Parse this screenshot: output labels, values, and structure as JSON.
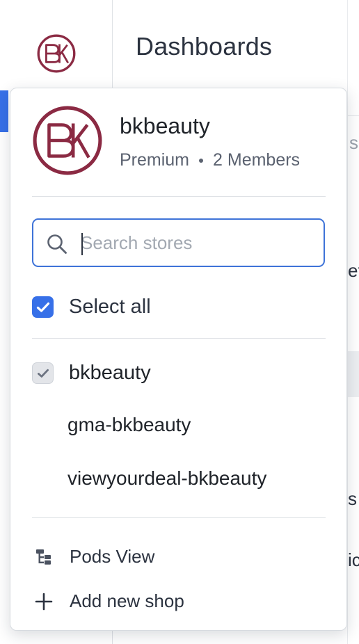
{
  "page": {
    "title": "Dashboards"
  },
  "background": {
    "fragments": [
      "s",
      "et",
      "s",
      "ic"
    ]
  },
  "colors": {
    "accent": "#3770e8",
    "brand": "#8b2a43",
    "search_border": "#3e73d8"
  },
  "org": {
    "logo_text": "BK",
    "name": "bkbeauty",
    "plan": "Premium",
    "members": "2 Members"
  },
  "search": {
    "placeholder": "Search stores",
    "value": ""
  },
  "select_all": {
    "label": "Select all",
    "checked": true
  },
  "stores": [
    {
      "name": "bkbeauty",
      "checked": true
    },
    {
      "name": "gma-bkbeauty",
      "checked": false
    },
    {
      "name": "viewyourdeal-bkbeauty",
      "checked": false
    }
  ],
  "actions": {
    "pods_view": {
      "label": "Pods View",
      "icon": "hierarchy-icon"
    },
    "add_shop": {
      "label": "Add new shop",
      "icon": "plus-icon"
    }
  }
}
